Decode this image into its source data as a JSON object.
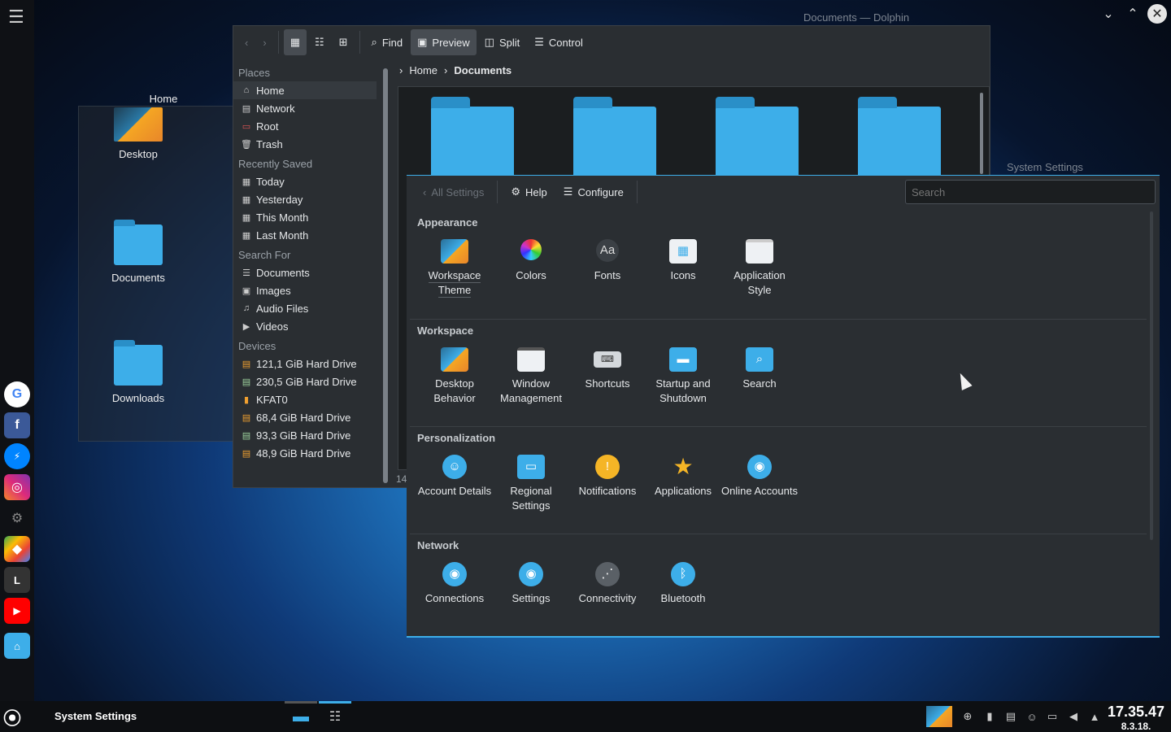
{
  "desktop": {
    "folder_view_title": "Home",
    "items": [
      {
        "label": "Desktop"
      },
      {
        "label": "Documents"
      },
      {
        "label": "Downloads"
      }
    ]
  },
  "dolphin": {
    "title": "Documents — Dolphin",
    "toolbar": {
      "find": "Find",
      "preview": "Preview",
      "split": "Split",
      "control": "Control"
    },
    "places": {
      "heading": "Places",
      "items": [
        "Home",
        "Network",
        "Root",
        "Trash"
      ]
    },
    "recently_saved": {
      "heading": "Recently Saved",
      "items": [
        "Today",
        "Yesterday",
        "This Month",
        "Last Month"
      ]
    },
    "search_for": {
      "heading": "Search For",
      "items": [
        "Documents",
        "Images",
        "Audio Files",
        "Videos"
      ]
    },
    "devices": {
      "heading": "Devices",
      "items": [
        "121,1 GiB Hard Drive",
        "230,5 GiB Hard Drive",
        "KFAT0",
        "68,4 GiB Hard Drive",
        "93,3 GiB Hard Drive",
        "48,9 GiB Hard Drive"
      ]
    },
    "breadcrumb": {
      "home": "Home",
      "current": "Documents"
    },
    "status": "14"
  },
  "settings": {
    "title": "System Settings",
    "toolbar": {
      "back": "All Settings",
      "help": "Help",
      "configure": "Configure"
    },
    "search_placeholder": "Search",
    "categories": [
      {
        "title": "Appearance",
        "items": [
          "Workspace Theme",
          "Colors",
          "Fonts",
          "Icons",
          "Application Style"
        ]
      },
      {
        "title": "Workspace",
        "items": [
          "Desktop Behavior",
          "Window Management",
          "Shortcuts",
          "Startup and Shutdown",
          "Search"
        ]
      },
      {
        "title": "Personalization",
        "items": [
          "Account Details",
          "Regional Settings",
          "Notifications",
          "Applications",
          "Online Accounts"
        ]
      },
      {
        "title": "Network",
        "items": [
          "Connections",
          "Settings",
          "Connectivity",
          "Bluetooth"
        ]
      }
    ]
  },
  "taskbar": {
    "active_title": "System Settings",
    "time": "17.35.47",
    "date": "8.3.18."
  },
  "dock": {
    "apps": [
      "google-icon",
      "facebook-icon",
      "messenger-icon",
      "instagram-icon",
      "kde-icon",
      "maps-icon",
      "l-app-icon",
      "youtube-icon",
      "home-folder-icon"
    ],
    "l_app_label": "L"
  },
  "colors": {
    "accent": "#3daee9",
    "window_bg": "#2a2e32",
    "view_bg": "#1b1e20"
  }
}
